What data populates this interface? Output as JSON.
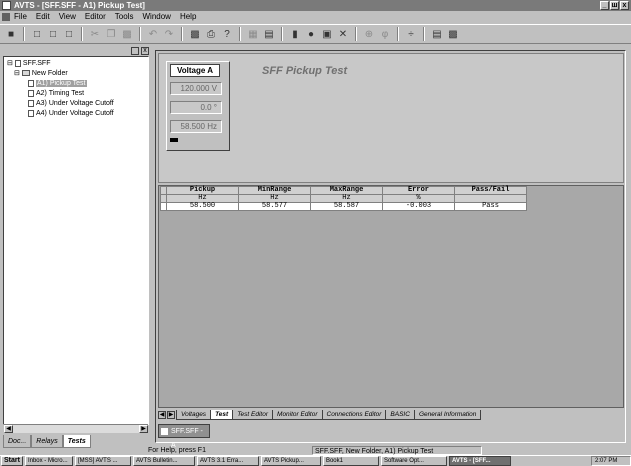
{
  "window": {
    "title": "AVTS - [SFF.SFF - A1) Pickup Test]",
    "buttons": [
      "_",
      "ш",
      "x"
    ]
  },
  "menu": [
    "File",
    "Edit",
    "View",
    "Editor",
    "Tools",
    "Window",
    "Help"
  ],
  "tree": {
    "root": "SFF.SFF",
    "folder": "New Folder",
    "items": [
      "A1) Pickup Test",
      "A2) Timing Test",
      "A3) Under Voltage Cutoff",
      "A4) Under Voltage Cutoff"
    ]
  },
  "left_tabs": [
    "Doc...",
    "Relays",
    "Tests"
  ],
  "voltage_box": {
    "title": "Voltage A",
    "values": [
      "120.000 V",
      "0.0 °",
      "58.500 Hz"
    ]
  },
  "test_title": "SFF Pickup Test",
  "table": {
    "headers": [
      "Pickup",
      "MinRange",
      "MaxRange",
      "Error",
      "Pass/Fail"
    ],
    "units": [
      "Hz",
      "Hz",
      "Hz",
      "%",
      ""
    ],
    "rows": [
      [
        "58.500",
        "58.577",
        "58.587",
        "-0.003",
        "Pass"
      ]
    ]
  },
  "sheet_tabs": [
    "Voltages",
    "Test",
    "Test Editor",
    "Monitor Editor",
    "Connections Editor",
    "BASIC",
    "General Information"
  ],
  "bottom_tab": "SFF.SFF - A",
  "status": {
    "help": "For Help, press F1",
    "path": "SFF.SFF, New Folder, A1) Pickup Test"
  },
  "taskbar": {
    "start": "Start",
    "items": [
      "Inbox - Micro...",
      "[MSS] AVTS ...",
      "AVTS Bulletin...",
      "AVTS 3.1 Erra...",
      "AVTS Pickup...",
      "Book1",
      "Software Opt...",
      "AVTS - [SFF..."
    ],
    "clock": "2:07 PM"
  }
}
